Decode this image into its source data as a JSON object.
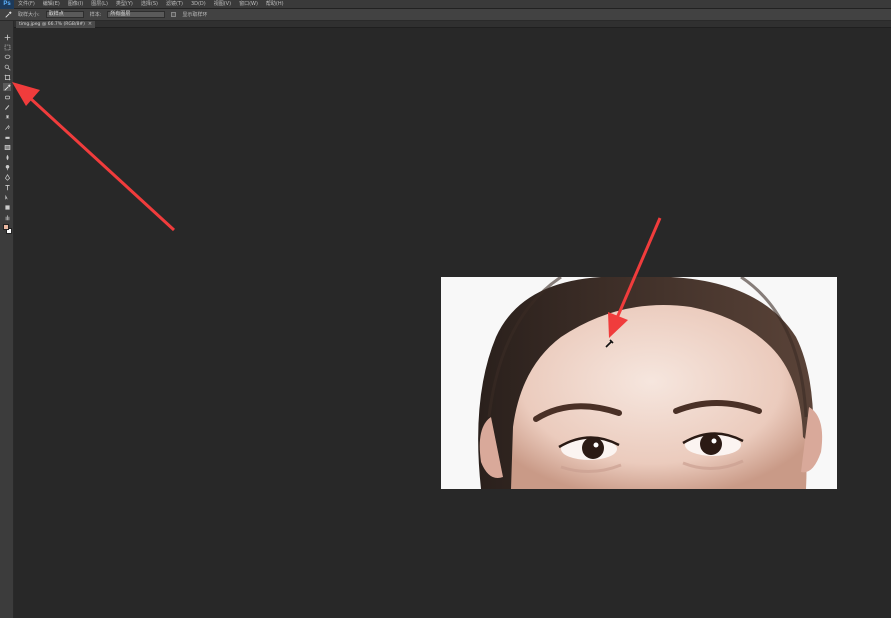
{
  "app": {
    "logo": "Ps",
    "menus": [
      "文件(F)",
      "编辑(E)",
      "图像(I)",
      "图层(L)",
      "类型(Y)",
      "选择(S)",
      "滤镜(T)",
      "3D(D)",
      "视图(V)",
      "窗口(W)",
      "帮助(H)"
    ]
  },
  "options_bar": {
    "size_label": "取样大小:",
    "size_value": "取样点",
    "sample_label": "样本:",
    "sample_value": "所有图层",
    "ring_label": "显示取样环"
  },
  "document": {
    "tab_title": "timg.jpeg @ 66.7% (RGB/8#)",
    "tab_close": "×"
  },
  "tools": [
    {
      "name": "move-tool"
    },
    {
      "name": "marquee-tool"
    },
    {
      "name": "lasso-tool"
    },
    {
      "name": "quick-select-tool"
    },
    {
      "name": "crop-tool"
    },
    {
      "name": "eyedropper-tool"
    },
    {
      "name": "healing-brush-tool"
    },
    {
      "name": "brush-tool"
    },
    {
      "name": "clone-stamp-tool"
    },
    {
      "name": "history-brush-tool"
    },
    {
      "name": "eraser-tool"
    },
    {
      "name": "gradient-tool"
    },
    {
      "name": "blur-tool"
    },
    {
      "name": "dodge-tool"
    },
    {
      "name": "pen-tool"
    },
    {
      "name": "type-tool"
    },
    {
      "name": "path-select-tool"
    },
    {
      "name": "shape-tool"
    },
    {
      "name": "hand-tool"
    },
    {
      "name": "zoom-tool"
    }
  ],
  "colors": {
    "foreground": "#e8b6a0",
    "background": "#ffffff",
    "annotation_arrow": "#f03c3c"
  }
}
